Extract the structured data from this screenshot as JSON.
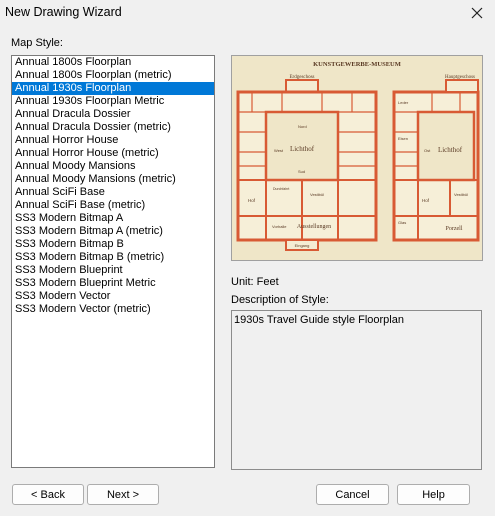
{
  "window": {
    "title": "New Drawing Wizard"
  },
  "map_style": {
    "label": "Map Style:",
    "items": [
      "Annual 1800s Floorplan",
      "Annual 1800s Floorplan (metric)",
      "Annual 1930s Floorplan",
      "Annual 1930s Floorplan Metric",
      "Annual Dracula Dossier",
      "Annual Dracula Dossier (metric)",
      "Annual Horror House",
      "Annual Horror House (metric)",
      "Annual Moody Mansions",
      "Annual Moody Mansions (metric)",
      "Annual SciFi Base",
      "Annual SciFi Base (metric)",
      "SS3 Modern Bitmap A",
      "SS3 Modern Bitmap A (metric)",
      "SS3 Modern Bitmap B",
      "SS3 Modern Bitmap B (metric)",
      "SS3 Modern Blueprint",
      "SS3 Modern Blueprint Metric",
      "SS3 Modern Vector",
      "SS3 Modern Vector (metric)"
    ],
    "selected_index": 2
  },
  "preview": {
    "title": "KUNSTGEWERBE-MUSEUM",
    "labels": {
      "left_top": "Erdgeschoss",
      "right_top": "Hauptgeschoss",
      "left_court": "Lichthof",
      "right_court": "Lichthof",
      "left_bottom": "Ausstellungen",
      "left_entry": "Eingang",
      "right_bottom": "Porzell",
      "left_west": "West",
      "left_nord": "Nord",
      "left_sud": "Sud",
      "left_hof": "Hof",
      "left_vestibul": "Vestibül",
      "left_vorhalle": "Vorhalle",
      "left_durchfahrt": "Durchfahrt",
      "right_hof": "Hof",
      "right_vestibul": "Vestibül",
      "right_lader": "Leder",
      "right_eisen": "Eisen",
      "right_glas": "Glas",
      "right_ost": "Ost"
    },
    "colors": {
      "paper": "#efe6c8",
      "ink": "#c9492b",
      "wall": "#d85a34"
    }
  },
  "unit": {
    "label": "Unit: Feet"
  },
  "description": {
    "label": "Description of Style:",
    "text": "1930s Travel Guide style Floorplan"
  },
  "buttons": {
    "back": "< Back",
    "next": "Next >",
    "cancel": "Cancel",
    "help": "Help"
  }
}
